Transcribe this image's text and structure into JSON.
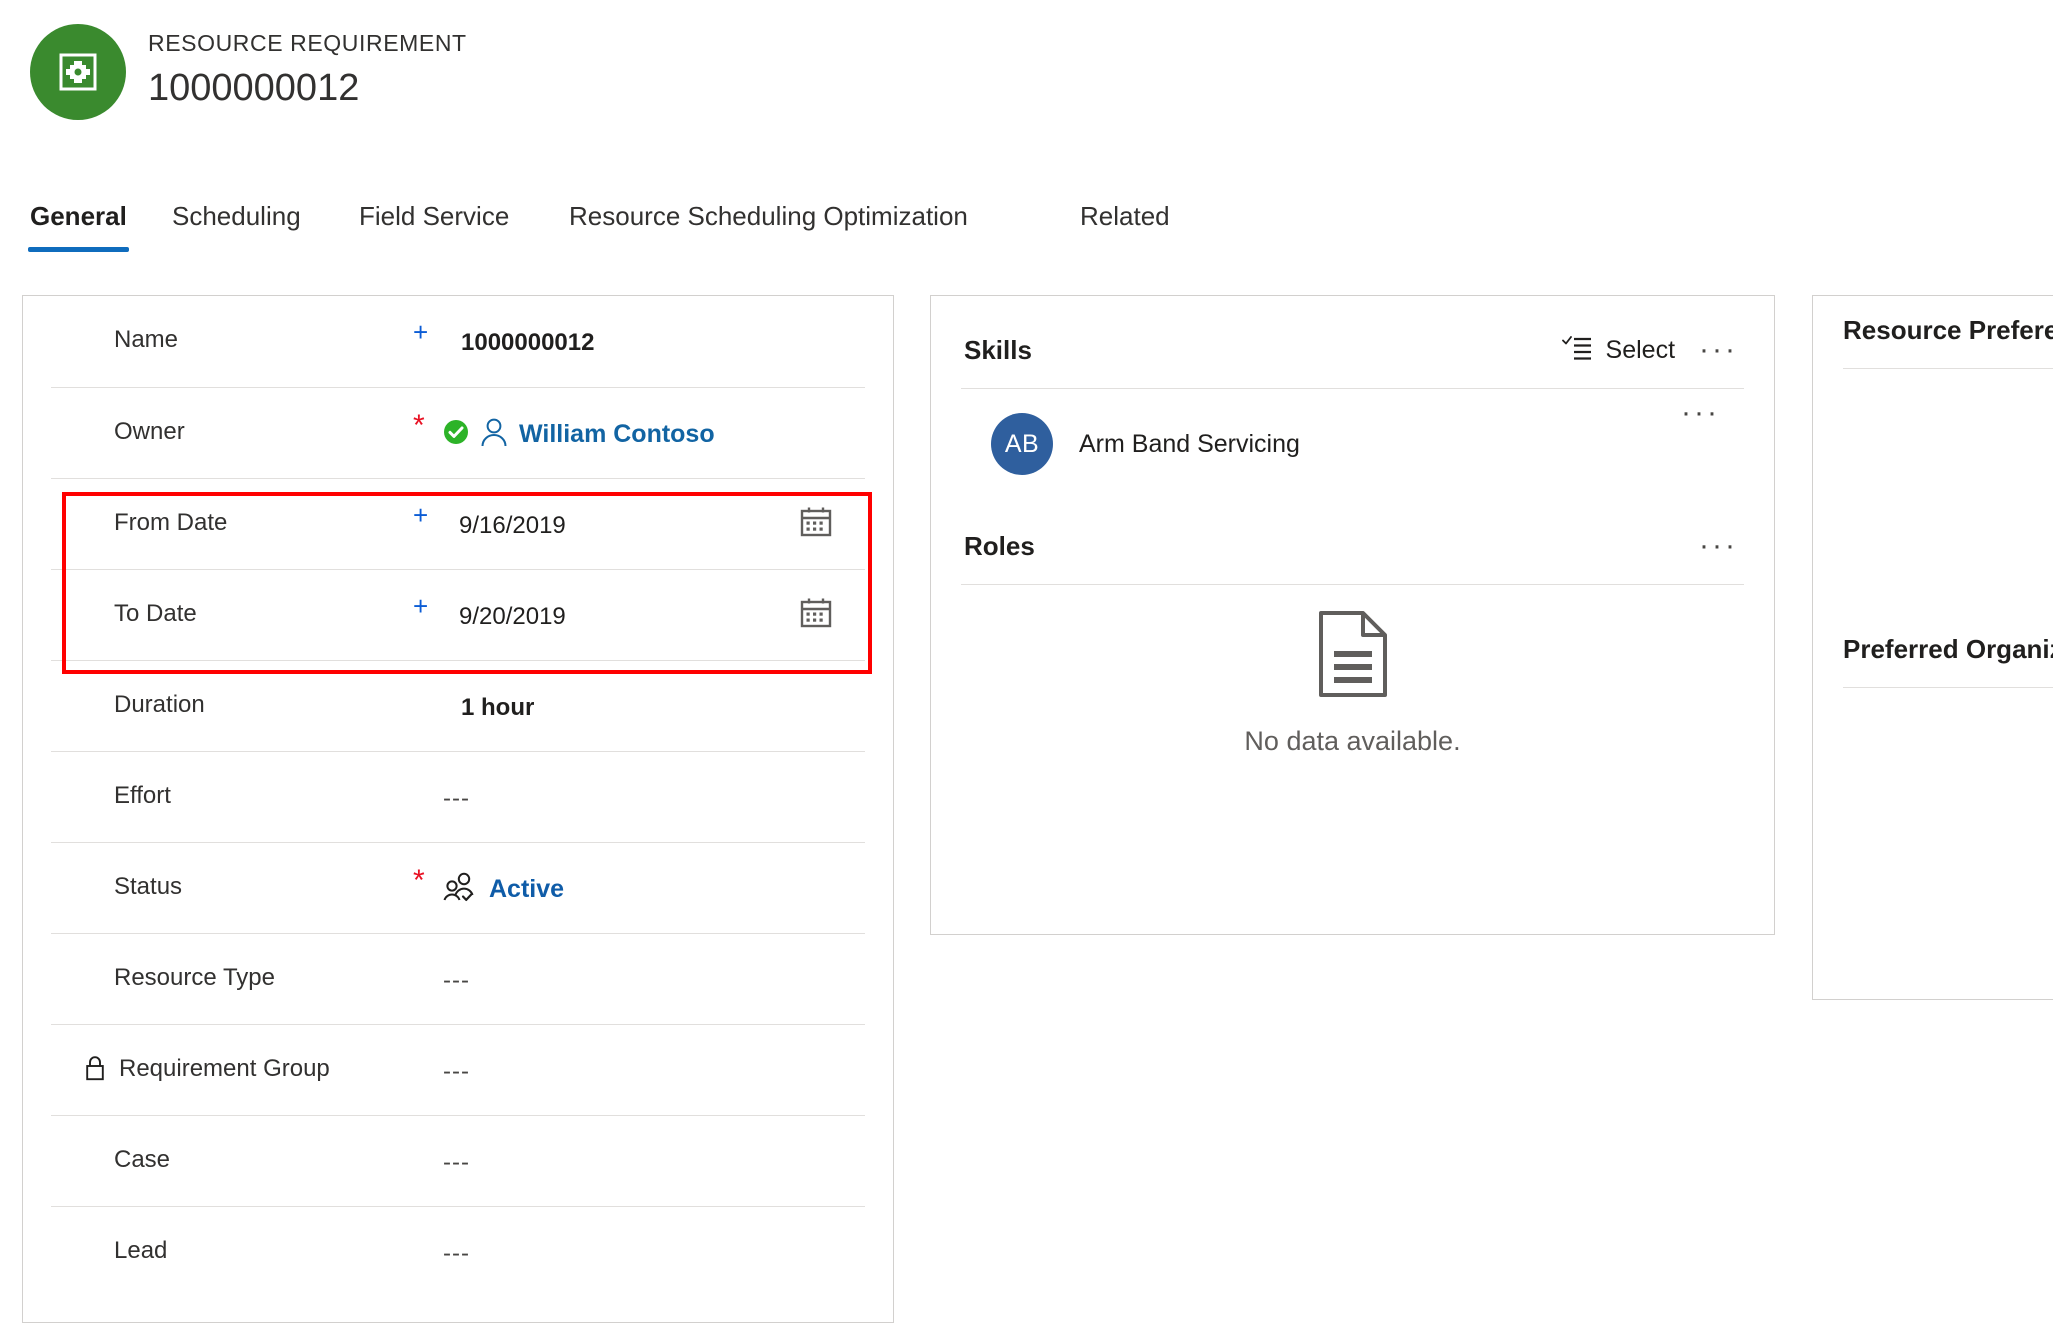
{
  "header": {
    "entity_type": "RESOURCE REQUIREMENT",
    "record_title": "1000000012",
    "avatar_icon": "resource-requirement-icon",
    "avatar_color": "#3a8a2e"
  },
  "tabs": [
    {
      "label": "General",
      "active": true
    },
    {
      "label": "Scheduling",
      "active": false
    },
    {
      "label": "Field Service",
      "active": false
    },
    {
      "label": "Resource Scheduling Optimization",
      "active": false
    },
    {
      "label": "Related",
      "active": false
    }
  ],
  "accent_color": "#0f6cbd",
  "annotation": {
    "color": "#ff0000",
    "target": "from-date-and-to-date-rows"
  },
  "general_form": {
    "rows": [
      {
        "label": "Name",
        "required": "plus",
        "value": "1000000012",
        "value_style": "bold"
      },
      {
        "label": "Owner",
        "required": "star",
        "value": "William Contoso",
        "value_style": "owner-link",
        "icons": [
          "verified-check-icon",
          "person-icon"
        ]
      },
      {
        "label": "From Date",
        "required": "plus",
        "value": "9/16/2019",
        "value_style": "plain",
        "trailing_icon": "calendar-icon",
        "highlighted": true
      },
      {
        "label": "To Date",
        "required": "plus",
        "value": "9/20/2019",
        "value_style": "plain",
        "trailing_icon": "calendar-icon",
        "highlighted": true
      },
      {
        "label": "Duration",
        "required": "",
        "value": "1 hour",
        "value_style": "bold"
      },
      {
        "label": "Effort",
        "required": "",
        "value": "---",
        "value_style": "dashes"
      },
      {
        "label": "Status",
        "required": "star",
        "value": "Active",
        "value_style": "status-link",
        "icons": [
          "people-check-icon"
        ]
      },
      {
        "label": "Resource Type",
        "required": "",
        "value": "---",
        "value_style": "dashes"
      },
      {
        "label": "Requirement Group",
        "required": "",
        "value": "---",
        "value_style": "dashes",
        "locked": true
      },
      {
        "label": "Case",
        "required": "",
        "value": "---",
        "value_style": "dashes"
      },
      {
        "label": "Lead",
        "required": "",
        "value": "---",
        "value_style": "dashes"
      }
    ]
  },
  "skills_section": {
    "title": "Skills",
    "select_label": "Select",
    "select_icon": "checklist-icon",
    "overflow_label": "···",
    "items": [
      {
        "initials": "AB",
        "name": "Arm Band Servicing",
        "avatar_color": "#2f5f9e",
        "overflow_label": "···"
      }
    ]
  },
  "roles_section": {
    "title": "Roles",
    "overflow_label": "···",
    "empty_text": "No data available.",
    "empty_icon": "document-icon"
  },
  "preferences_card": {
    "title": "Resource Preferen",
    "subsection_title": "Preferred Organiz"
  }
}
